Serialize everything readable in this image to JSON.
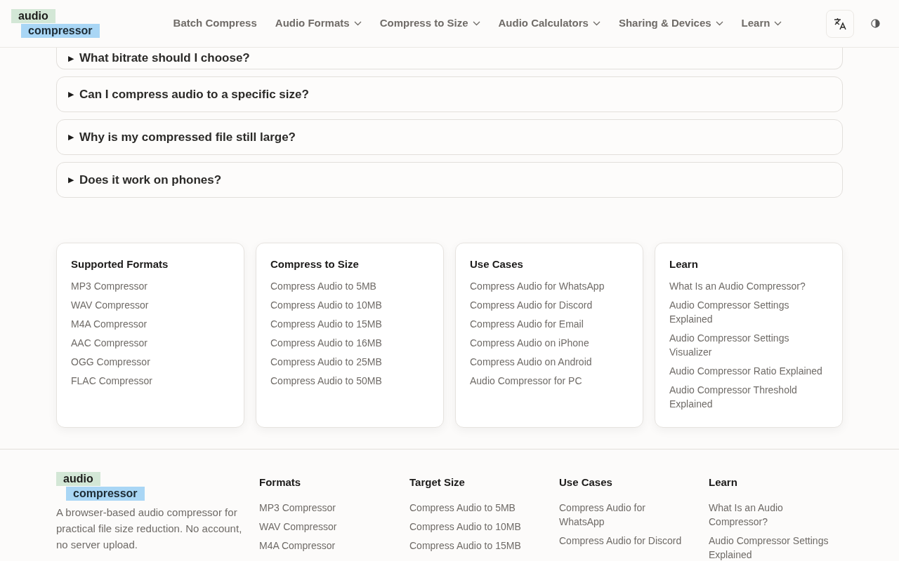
{
  "header": {
    "logo": {
      "line_1": "audio",
      "line_2": "compressor"
    },
    "nav": [
      {
        "label": "Batch Compress",
        "has_menu": false
      },
      {
        "label": "Audio Formats",
        "has_menu": true
      },
      {
        "label": "Compress to Size",
        "has_menu": true
      },
      {
        "label": "Audio Calculators",
        "has_menu": true
      },
      {
        "label": "Sharing & Devices",
        "has_menu": true
      },
      {
        "label": "Learn",
        "has_menu": true
      }
    ]
  },
  "faq": [
    {
      "marker": "▶",
      "question": "What bitrate should I choose?"
    },
    {
      "marker": "▶",
      "question": "Can I compress audio to a specific size?"
    },
    {
      "marker": "▶",
      "question": "Why is my compressed file still large?"
    },
    {
      "marker": "▶",
      "question": "Does it work on phones?"
    }
  ],
  "link_cards": [
    {
      "title": "Supported Formats",
      "links": [
        "MP3 Compressor",
        "WAV Compressor",
        "M4A Compressor",
        "AAC Compressor",
        "OGG Compressor",
        "FLAC Compressor"
      ]
    },
    {
      "title": "Compress to Size",
      "links": [
        "Compress Audio to 5MB",
        "Compress Audio to 10MB",
        "Compress Audio to 15MB",
        "Compress Audio to 16MB",
        "Compress Audio to 25MB",
        "Compress Audio to 50MB"
      ]
    },
    {
      "title": "Use Cases",
      "links": [
        "Compress Audio for WhatsApp",
        "Compress Audio for Discord",
        "Compress Audio for Email",
        "Compress Audio on iPhone",
        "Compress Audio on Android",
        "Audio Compressor for PC"
      ]
    },
    {
      "title": "Learn",
      "links": [
        "What Is an Audio Compressor?",
        "Audio Compressor Settings Explained",
        "Audio Compressor Settings Visualizer",
        "Audio Compressor Ratio Explained",
        "Audio Compressor Threshold Explained"
      ]
    }
  ],
  "footer": {
    "logo": {
      "line_1": "audio",
      "line_2": "compressor"
    },
    "description": "A browser-based audio compressor for practical file size reduction. No account, no server upload.",
    "columns": [
      {
        "title": "Formats",
        "links": [
          "MP3 Compressor",
          "WAV Compressor",
          "M4A Compressor"
        ]
      },
      {
        "title": "Target Size",
        "links": [
          "Compress Audio to 5MB",
          "Compress Audio to 10MB",
          "Compress Audio to 15MB"
        ]
      },
      {
        "title": "Use Cases",
        "links": [
          "Compress Audio for WhatsApp",
          "Compress Audio for Discord"
        ]
      },
      {
        "title": "Learn",
        "links": [
          "What Is an Audio Compressor?",
          "Audio Compressor Settings Explained"
        ]
      }
    ]
  }
}
